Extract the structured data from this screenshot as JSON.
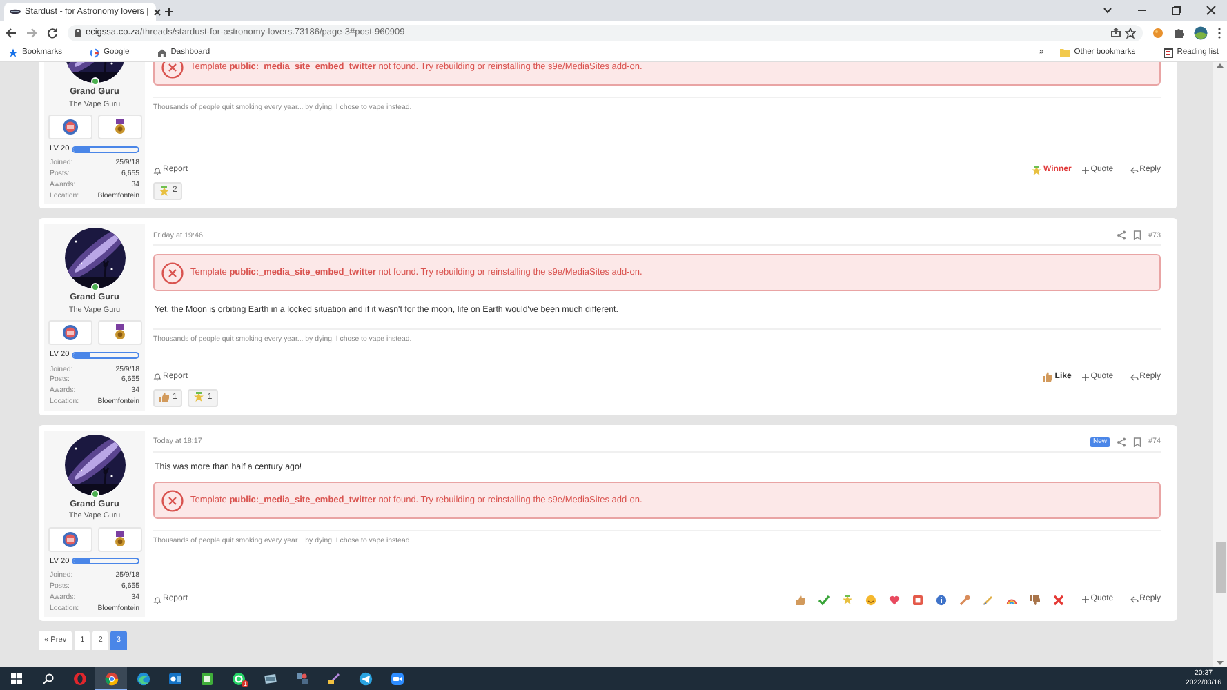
{
  "browser": {
    "tab": {
      "title": "Stardust - for Astronomy lovers |",
      "selected": true
    },
    "url_host": "ecigssa.co.za",
    "url_path": "/threads/stardust-for-astronomy-lovers.73186/page-3#post-960909",
    "bookmarks": [
      {
        "label": "Bookmarks"
      },
      {
        "label": "Google"
      },
      {
        "label": "Dashboard"
      }
    ],
    "overflow": "»",
    "other_bookmarks": "Other bookmarks",
    "reading_list": "Reading list"
  },
  "posts": [
    {
      "user": {
        "name": "Grand Guru",
        "title": "The Vape Guru",
        "online": true,
        "level_label": "LV 20",
        "level": 0.25,
        "stats": [
          {
            "label": "Joined:",
            "value": "25/9/18"
          },
          {
            "label": "Posts:",
            "value": "6,655"
          },
          {
            "label": "Awards:",
            "value": "34"
          },
          {
            "label": "Location:",
            "value": "Bloemfontein"
          }
        ]
      },
      "error": "Template **public:_media_site_embed_twitter** not found. Try rebuilding or reinstalling the s9e/MediaSites add-on.",
      "signature": "Thousands of people quit smoking every year... by dying. I chose to vape instead.",
      "report": "Report",
      "reaction": {
        "kind": "winner",
        "label": "Winner"
      },
      "quote": "Quote",
      "reply": "Reply",
      "reactions": [
        {
          "kind": "winner",
          "count": "2"
        }
      ]
    },
    {
      "date": "Friday at 19:46",
      "number": "#73",
      "user": {
        "name": "Grand Guru",
        "title": "The Vape Guru",
        "online": true,
        "level_label": "LV 20",
        "level": 0.25,
        "stats": [
          {
            "label": "Joined:",
            "value": "25/9/18"
          },
          {
            "label": "Posts:",
            "value": "6,655"
          },
          {
            "label": "Awards:",
            "value": "34"
          },
          {
            "label": "Location:",
            "value": "Bloemfontein"
          }
        ]
      },
      "error": "Template **public:_media_site_embed_twitter** not found. Try rebuilding or reinstalling the s9e/MediaSites add-on.",
      "body": "Yet, the Moon is orbiting Earth in a locked situation and if it wasn't for the moon, life on Earth would've been much different.",
      "signature": "Thousands of people quit smoking every year... by dying. I chose to vape instead.",
      "report": "Report",
      "reaction": {
        "kind": "like",
        "label": "Like"
      },
      "quote": "Quote",
      "reply": "Reply",
      "reactions": [
        {
          "kind": "like",
          "count": "1"
        },
        {
          "kind": "winner",
          "count": "1"
        }
      ]
    },
    {
      "date": "Today at 18:17",
      "badge": "New",
      "number": "#74",
      "user": {
        "name": "Grand Guru",
        "title": "The Vape Guru",
        "online": true,
        "level_label": "LV 20",
        "level": 0.25,
        "stats": [
          {
            "label": "Joined:",
            "value": "25/9/18"
          },
          {
            "label": "Posts:",
            "value": "6,655"
          },
          {
            "label": "Awards:",
            "value": "34"
          },
          {
            "label": "Location:",
            "value": "Bloemfontein"
          }
        ]
      },
      "body_first": "This was more than half a century ago!",
      "error": "Template **public:_media_site_embed_twitter** not found. Try rebuilding or reinstalling the s9e/MediaSites add-on.",
      "signature": "Thousands of people quit smoking every year... by dying. I chose to vape instead.",
      "report": "Report",
      "reaction": {
        "kind": "picker"
      },
      "quote": "Quote",
      "reply": "Reply"
    }
  ],
  "pagination": {
    "prev": "« Prev",
    "pages": [
      {
        "label": "1",
        "selected": false
      },
      {
        "label": "2",
        "selected": false
      },
      {
        "label": "3",
        "selected": true
      }
    ]
  },
  "taskbar": {
    "apps": [
      {
        "selected": false
      },
      {
        "selected": true
      },
      {
        "selected": false
      },
      {
        "selected": false
      },
      {
        "selected": false
      },
      {
        "selected": false,
        "badge": "1"
      },
      {
        "selected": false
      },
      {
        "selected": false
      },
      {
        "selected": false
      },
      {
        "selected": false
      },
      {
        "selected": false
      }
    ],
    "time": "20:37",
    "date": "2022/03/16"
  }
}
